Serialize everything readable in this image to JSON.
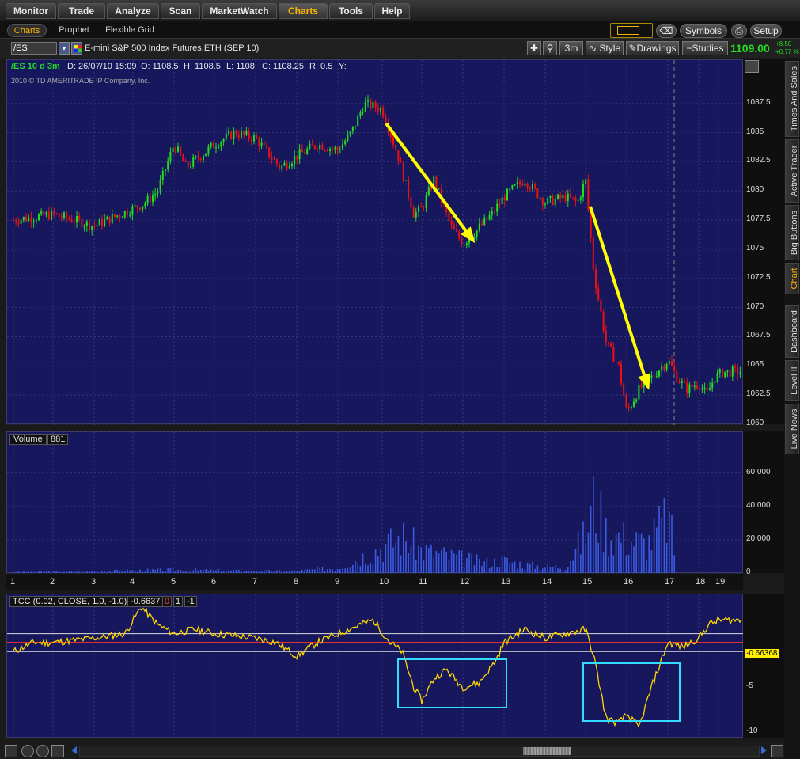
{
  "menu": {
    "tabs": [
      {
        "label": "Monitor",
        "active": false
      },
      {
        "label": "Trade",
        "active": false
      },
      {
        "label": "Analyze",
        "active": false
      },
      {
        "label": "Scan",
        "active": false
      },
      {
        "label": "MarketWatch",
        "active": false
      },
      {
        "label": "Charts",
        "active": true
      },
      {
        "label": "Tools",
        "active": false
      },
      {
        "label": "Help",
        "active": false
      }
    ]
  },
  "subtabs": [
    {
      "label": "Charts",
      "active": true
    },
    {
      "label": "Prophet",
      "active": false
    },
    {
      "label": "Flexible Grid",
      "active": false
    }
  ],
  "toolbar": {
    "symbols_label": "Symbols",
    "setup_label": "Setup",
    "price_change": "+8.50",
    "pct_change": "+0.77 %"
  },
  "chartbar": {
    "symbol": "/ES",
    "description": "E-mini S&P 500 Index Futures,ETH (SEP 10)",
    "timeframe": "3m",
    "style_label": "Style",
    "drawings_label": "Drawings",
    "studies_label": "Studies",
    "last_price": "1109.00"
  },
  "chart": {
    "header": {
      "symbol_period": "/ES 10 d 3m",
      "date": "D: 26/07/10 15:09",
      "open": "O: 1108.5",
      "high": "H: 1108.5",
      "low": "L: 1108",
      "close": "C: 1108.25",
      "range": "R: 0.5",
      "y": "Y:"
    },
    "copyright": "2010 © TD AMERITRADE IP Company, Inc.",
    "volume_label": "Volume",
    "volume_value": "881",
    "tcc_label": "TCC (0.02, CLOSE, 1.0, -1.0)",
    "tcc_value": "-0.6637",
    "tcc_p1": "0",
    "tcc_p2": "1",
    "tcc_p3": "-1",
    "tcc_current_label": "-0.66368"
  },
  "colors": {
    "panel_bg": "#17175e",
    "up_candle": "#22dd22",
    "down_candle": "#ee1111",
    "arrow": "#ffff00",
    "tcc_line": "#ffd700",
    "box": "#33ddff",
    "volume_bar": "#3a5be0"
  },
  "side_tabs": [
    "Times And Sales",
    "Active Trader",
    "Big Buttons",
    "Chart",
    "Dashboard",
    "Level II",
    "Live News"
  ],
  "chart_data": [
    {
      "type": "line",
      "title": "/ES 10 d 3m",
      "ylim": [
        1060,
        1088.5
      ],
      "yticks": [
        "1087.5",
        "1085",
        "1082.5",
        "1080",
        "1077.5",
        "1075",
        "1072.5",
        "1070",
        "1067.5",
        "1065",
        "1062.5",
        "1060"
      ],
      "xticks": [
        "1",
        "2",
        "3",
        "4",
        "5",
        "6",
        "7",
        "8",
        "9",
        "10",
        "11",
        "12",
        "13",
        "14",
        "15",
        "16",
        "17",
        "18",
        "19"
      ],
      "x": [
        1,
        2,
        3,
        4,
        4.3,
        4.6,
        5,
        5.3,
        6,
        6.5,
        7,
        7.6,
        8,
        8.5,
        9,
        9.3,
        9.6,
        10,
        10.4,
        10.8,
        11,
        11.3,
        11.7,
        12,
        12.3,
        12.7,
        13,
        13.5,
        14,
        14.5,
        14.8,
        15,
        15.2,
        15.5,
        15.8,
        16,
        16.3,
        16.6,
        17,
        17.3,
        17.6,
        18,
        18.4,
        18.8,
        19.2
      ],
      "values": [
        1077.5,
        1078,
        1077,
        1078.5,
        1079,
        1080,
        1084,
        1082,
        1084,
        1085,
        1084.5,
        1082,
        1083,
        1084,
        1083.5,
        1085,
        1087.5,
        1087,
        1083,
        1078,
        1078.5,
        1081,
        1077,
        1075.5,
        1076.5,
        1078,
        1079.5,
        1081,
        1079,
        1079.5,
        1079,
        1081,
        1073,
        1067,
        1065,
        1061,
        1063,
        1064,
        1065.5,
        1064,
        1063,
        1063.5,
        1062.5,
        1064,
        1064.5
      ]
    },
    {
      "type": "bar",
      "title": "Volume",
      "ylim": [
        0,
        75000
      ],
      "yticks": [
        "60,000",
        "40,000",
        "20,000",
        "0"
      ],
      "x": [
        1,
        2,
        3,
        4,
        5,
        6,
        7,
        8,
        9,
        10,
        10.5,
        11,
        11.5,
        12,
        12.5,
        13,
        13.5,
        14,
        14.5,
        15,
        15.2,
        15.5,
        16,
        16.5,
        17,
        17.3
      ],
      "values": [
        1000,
        1500,
        1500,
        2500,
        3000,
        2500,
        2000,
        2000,
        5000,
        25000,
        35000,
        22000,
        18000,
        14000,
        10000,
        12000,
        8000,
        6000,
        6000,
        38000,
        70000,
        40000,
        33000,
        28000,
        55000,
        10000
      ]
    },
    {
      "type": "line",
      "title": "TCC (0.02, CLOSE, 1.0, -1.0)",
      "ylim": [
        -10,
        4.5
      ],
      "yticks": [
        "-5",
        "-10"
      ],
      "x": [
        1,
        1.5,
        2,
        3,
        3.8,
        4.2,
        4.6,
        5,
        5.5,
        6,
        7,
        7.5,
        8,
        8.5,
        9,
        9.5,
        9.8,
        10.2,
        10.5,
        10.8,
        11,
        11.3,
        11.6,
        12,
        12.4,
        12.8,
        13,
        13.5,
        14,
        14.5,
        15,
        15.2,
        15.5,
        15.8,
        16,
        16.3,
        16.6,
        17,
        17.5,
        18,
        18.5,
        19
      ],
      "values": [
        -1,
        0,
        0,
        0.5,
        1,
        4,
        2,
        1,
        1.5,
        1,
        0.5,
        0,
        -1.5,
        0,
        1,
        2,
        2.5,
        0,
        -1,
        -5,
        -6.5,
        -4,
        -3,
        -5,
        -4.5,
        -2,
        0,
        1.5,
        0.5,
        1,
        1.5,
        -1.5,
        -8.5,
        -9,
        -8,
        -9.5,
        -5,
        0,
        -0.5,
        0.5,
        2,
        2.5
      ]
    }
  ]
}
